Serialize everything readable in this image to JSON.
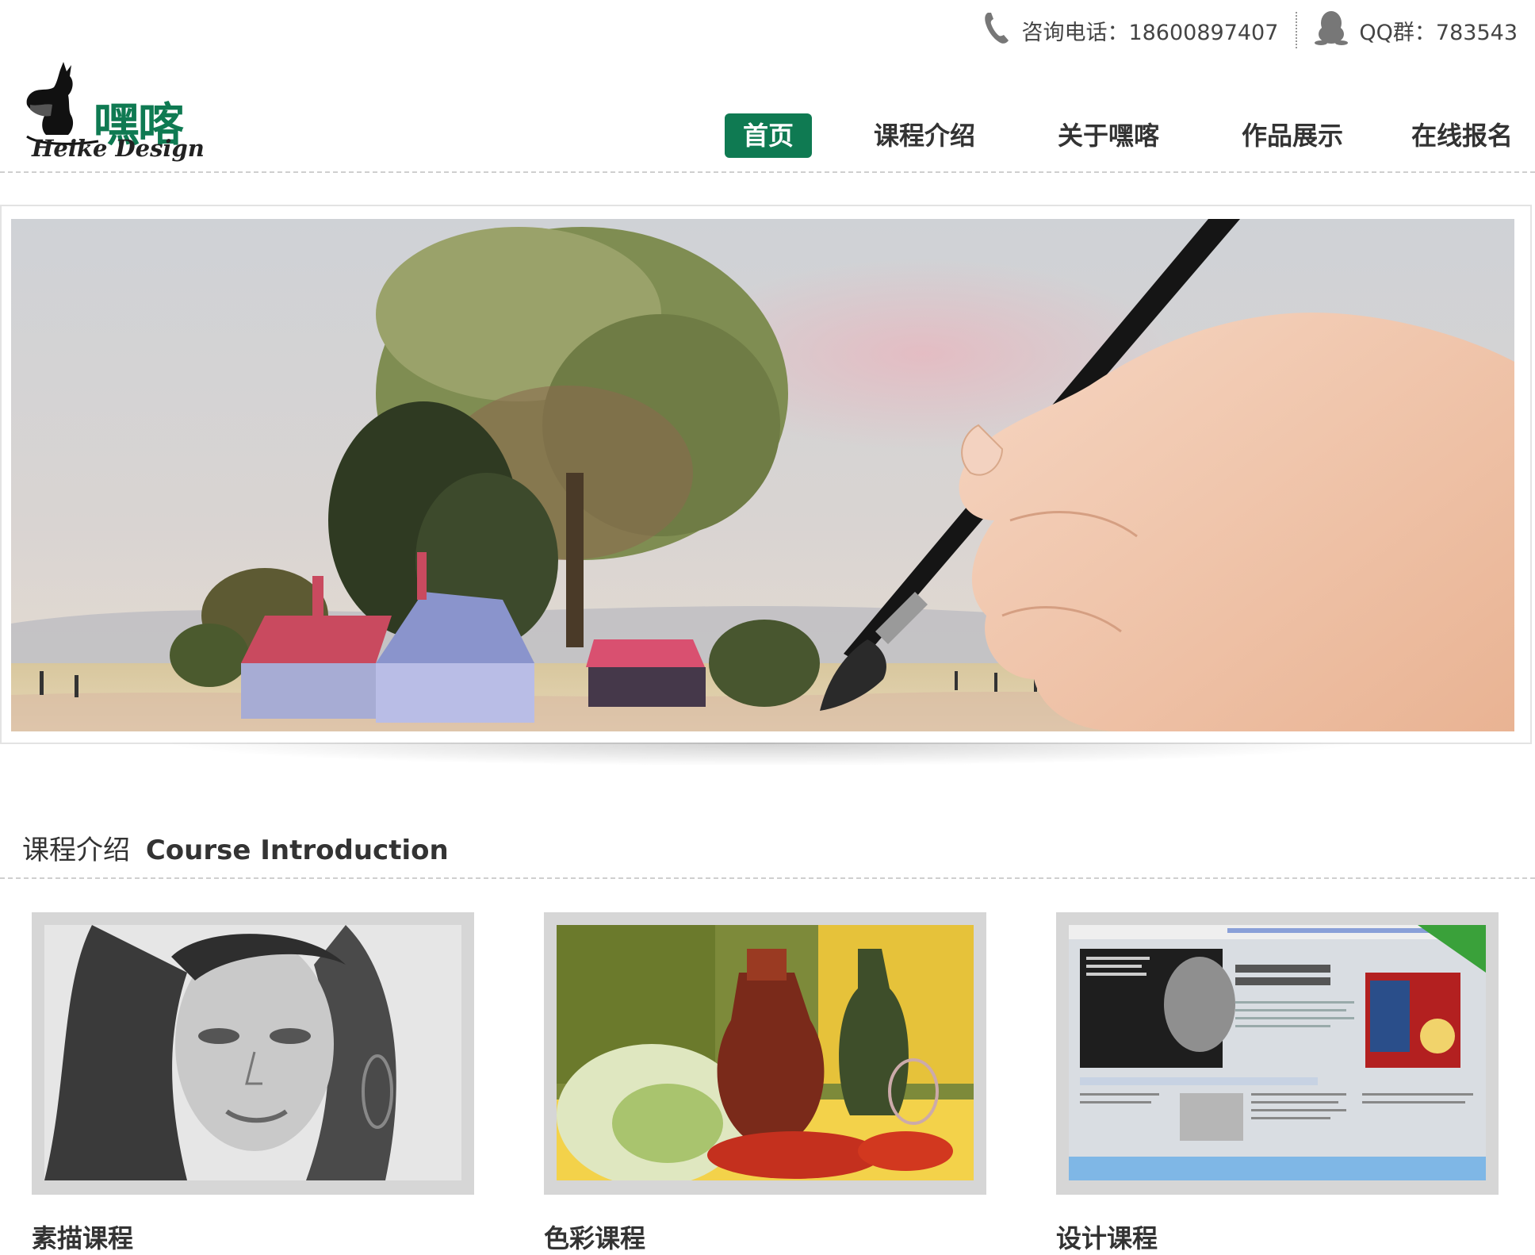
{
  "topbar": {
    "phone_label": "咨询电话：18600897407",
    "qq_label": "QQ群：783543"
  },
  "logo": {
    "cn": "嘿喀",
    "en": "Heike Design"
  },
  "nav": {
    "items": [
      {
        "label": "首页",
        "active": true
      },
      {
        "label": "课程介绍",
        "active": false
      },
      {
        "label": "关于嘿喀",
        "active": false
      },
      {
        "label": "作品展示",
        "active": false
      },
      {
        "label": "在线报名",
        "active": false
      }
    ]
  },
  "section": {
    "title_cn": "课程介绍",
    "title_en": "Course Introduction"
  },
  "cards": [
    {
      "title": "素描课程",
      "thumb_alt": "sketch-portrait"
    },
    {
      "title": "色彩课程",
      "thumb_alt": "still-life-painting"
    },
    {
      "title": "设计课程",
      "thumb_alt": "website-design"
    }
  ],
  "colors": {
    "brand": "#0f7a52",
    "text": "#333333",
    "card_bg": "#d6d6d6"
  }
}
